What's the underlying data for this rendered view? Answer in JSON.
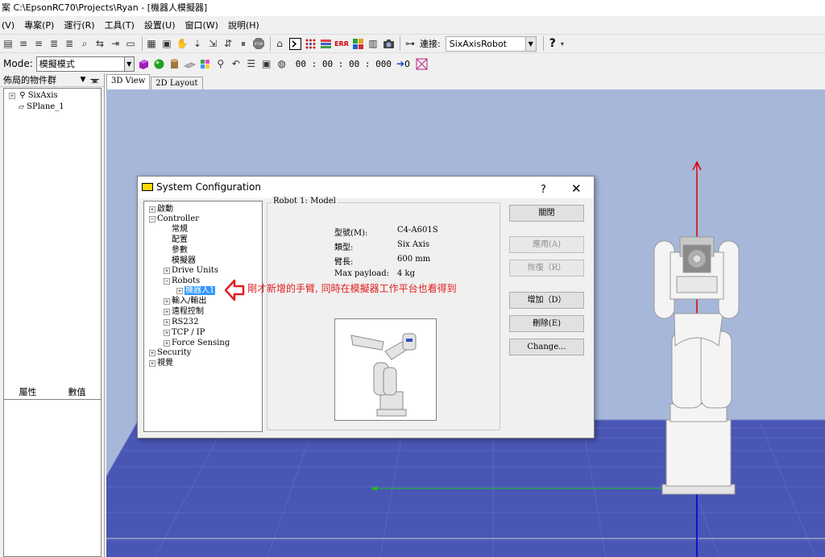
{
  "window": {
    "title": "案 C:\\EpsonRC70\\Projects\\Ryan - [機器人模擬器]"
  },
  "menu": [
    "(V)",
    "專案(P)",
    "運行(R)",
    "工具(T)",
    "設置(U)",
    "窗口(W)",
    "說明(H)"
  ],
  "toolbar1": {
    "connect_label": "連接:",
    "connect_value": "SixAxisRobot",
    "help_glyph": "?"
  },
  "toolbar2": {
    "mode_label": "Mode:",
    "mode_value": "模擬模式",
    "time": "00 : 00 : 00 : 000",
    "counter": "0"
  },
  "left_panel": {
    "title": "佈局的物件群",
    "tree": [
      "SixAxis",
      "SPlane_1"
    ],
    "columns": [
      "屬性",
      "數值"
    ]
  },
  "view_tabs": [
    "3D View",
    "2D Layout"
  ],
  "dialog": {
    "title": "System Configuration",
    "help": "?",
    "close": "✕",
    "tree": {
      "startup": "啟動",
      "controller": "Controller",
      "general": "常規",
      "config": "配置",
      "params": "參數",
      "simulator": "模擬器",
      "drive_units": "Drive Units",
      "robots": "Robots",
      "robot1": "機器人1",
      "io": "輸入/輸出",
      "remote": "遠程控制",
      "rs232": "RS232",
      "tcpip": "TCP / IP",
      "force": "Force Sensing",
      "security": "Security",
      "vision": "視覺"
    },
    "group_title": "Robot 1: Model",
    "props": [
      {
        "label": "型號(M):",
        "value": "C4-A601S"
      },
      {
        "label": "類型:",
        "value": "Six Axis"
      },
      {
        "label": "臂長:",
        "value": "600 mm"
      },
      {
        "label": "Max payload:",
        "value": "4 kg"
      }
    ],
    "buttons": {
      "close": "關閉",
      "apply": "應用(A)",
      "restore": "恢復（R）",
      "add": "增加（D）",
      "delete": "刪除(E)",
      "change": "Change..."
    }
  },
  "annotation": "剛才新增的手臂, 同時在模擬器工作平台也看得到",
  "colors": {
    "sky": "#a6b7da",
    "floor": "#4956b4",
    "annotation": "#e02020",
    "selection": "#3399ff"
  }
}
